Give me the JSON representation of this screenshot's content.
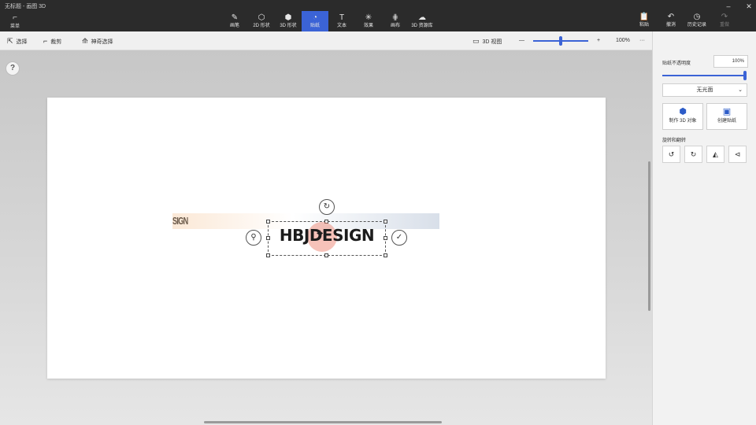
{
  "app": {
    "title": "无标题 - 画图 3D"
  },
  "ribbon": {
    "menu_label": "菜单",
    "tools": [
      {
        "name": "brushes",
        "icon": "brush-icon",
        "label": "画笔"
      },
      {
        "name": "2d-shapes",
        "icon": "2d-shapes-icon",
        "label": "2D 形状"
      },
      {
        "name": "3d-shapes",
        "icon": "3d-shapes-icon",
        "label": "3D 形状"
      },
      {
        "name": "stickers",
        "icon": "stickers-icon",
        "label": "贴纸",
        "active": true
      },
      {
        "name": "text",
        "icon": "text-icon",
        "label": "文本"
      },
      {
        "name": "effects",
        "icon": "effects-icon",
        "label": "效果"
      },
      {
        "name": "canvas",
        "icon": "canvas-icon",
        "label": "画布"
      },
      {
        "name": "3d-library",
        "icon": "3d-library-icon",
        "label": "3D 资源库"
      }
    ],
    "right_tools": [
      {
        "name": "paste",
        "icon": "paste-icon",
        "label": "粘贴"
      },
      {
        "name": "undo",
        "icon": "undo-icon",
        "label": "撤消"
      },
      {
        "name": "history",
        "icon": "history-icon",
        "label": "历史记录"
      },
      {
        "name": "redo",
        "icon": "redo-icon",
        "label": "重做"
      }
    ]
  },
  "toolbar2": {
    "select_label": "选择",
    "crop_label": "裁剪",
    "magic_select_label": "神奇选择",
    "view_3d_label": "3D 视图",
    "zoom_minus": "—",
    "zoom_plus": "+",
    "zoom_value": "100%",
    "zoom_level": 0.48,
    "more": "···"
  },
  "canvas": {
    "banner_text": "SIGN",
    "sticker_text": "HBJDESIGN"
  },
  "panel": {
    "opacity_label": "贴纸不透明度",
    "opacity_value": "100%",
    "opacity_level": 1.0,
    "material_value": "无光面",
    "make_3d_label": "制作 3D 对象",
    "sticker_label": "创建贴纸",
    "rotate_flip_label": "旋转和翻转"
  }
}
